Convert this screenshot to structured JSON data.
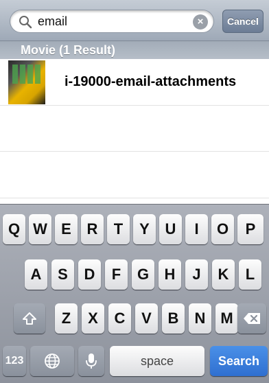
{
  "search": {
    "query": "email",
    "clear_glyph": "×",
    "cancel_label": "Cancel"
  },
  "section": {
    "header": "Movie (1 Result)"
  },
  "results": [
    {
      "title": "i-19000-email-attachments"
    }
  ],
  "keyboard": {
    "row1": [
      "Q",
      "W",
      "E",
      "R",
      "T",
      "Y",
      "U",
      "I",
      "O",
      "P"
    ],
    "row2": [
      "A",
      "S",
      "D",
      "F",
      "G",
      "H",
      "J",
      "K",
      "L"
    ],
    "row3": [
      "Z",
      "X",
      "C",
      "V",
      "B",
      "N",
      "M"
    ],
    "numbers_label": "123",
    "space_label": "space",
    "search_label": "Search"
  }
}
